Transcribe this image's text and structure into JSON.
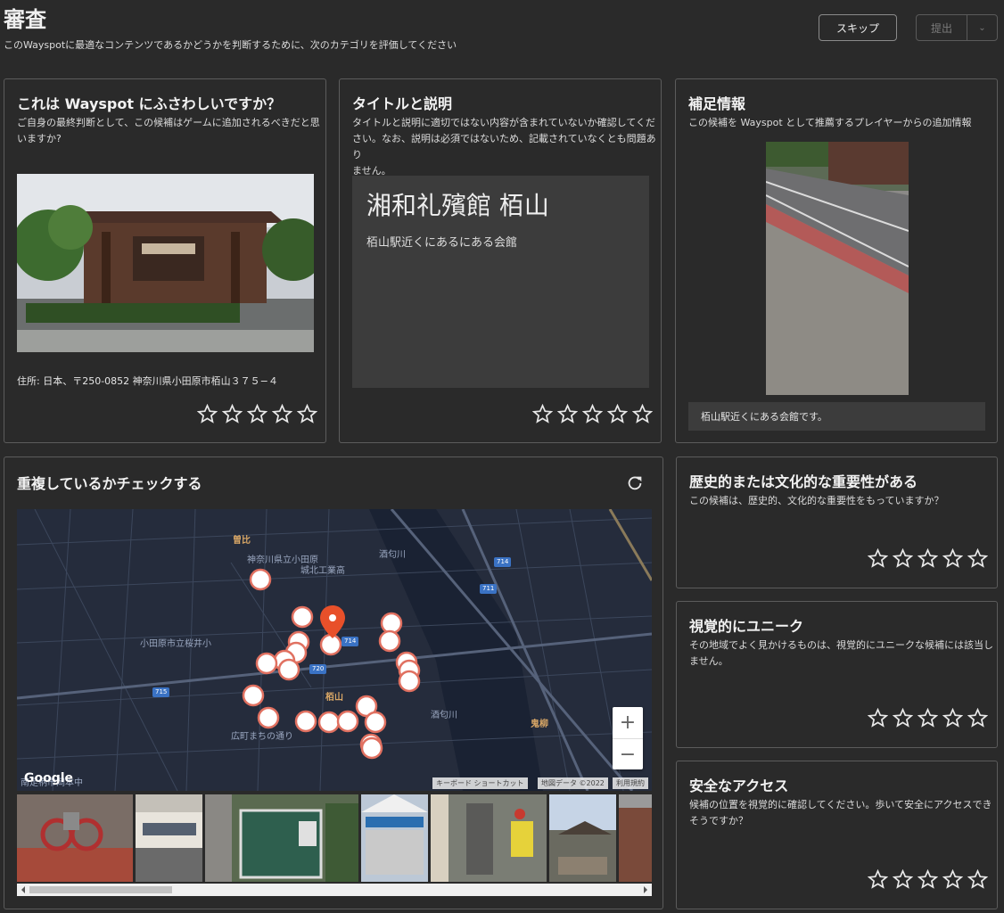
{
  "header": {
    "title": "審査",
    "subtitle": "このWayspotに最適なコンテンツであるかどうかを判断するために、次のカテゴリを評価してください",
    "skip_label": "スキップ",
    "submit_label": "提出",
    "dropdown_glyph": "⌄"
  },
  "cards": {
    "appropriate": {
      "title": "これは Wayspot にふさわしいですか？",
      "desc_line1": "ご自身の最終判断として、この候補はゲームに追加されるべきだと思",
      "desc_line2": "いますか?",
      "address": "住所: 日本、〒250-0852 神奈川県小田原市栢山３７５−４",
      "rating": 0
    },
    "title_desc": {
      "title": "タイトルと説明",
      "desc_line1": "タイトルと説明に適切ではない内容が含まれていないか確認してくだ",
      "desc_line2": "さい。なお、説明は必須ではないため、記載されていなくとも問題あり",
      "desc_line3": "ません。",
      "wayspot_title": "湘和礼殯館 栢山",
      "wayspot_desc": "栢山駅近くにあるにある会館",
      "rating": 0
    },
    "supplemental": {
      "title": "補足情報",
      "desc": "この候補を Wayspot として推薦するプレイヤーからの追加情報",
      "text": "栢山駅近くにある会館です。"
    },
    "duplicates": {
      "title": "重複しているかチェックする",
      "map": {
        "labels": {
          "soga": "曽比",
          "school1_l1": "神奈川県立小田原",
          "school1_l2": "城北工業高",
          "school2": "小田原市立桜井小",
          "kayama": "栢山",
          "kitayanagi": "鬼柳",
          "river1": "酒匂川",
          "river2": "酒匂川",
          "road_street": "広町まちの通り",
          "south": "南足柄市岡本中",
          "google": "Google",
          "badge_714a": "714",
          "badge_711": "711",
          "badge_714b": "714",
          "badge_720": "720",
          "badge_715": "715",
          "zoom_in": "+",
          "zoom_out": "−"
        },
        "attribution": {
          "shortcuts": "キーボード ショートカット",
          "data": "地図データ ©2022",
          "terms": "利用規約"
        }
      }
    },
    "historic": {
      "title": "歴史的または文化的な重要性がある",
      "desc": "この候補は、歴史的、文化的な重要性をもっていますか？",
      "rating": 0
    },
    "visual": {
      "title": "視覚的にユニーク",
      "desc_line1": "その地域でよく見かけるものは、視覚的にユニークな候補には該当し",
      "desc_line2": "ません。",
      "rating": 0
    },
    "access": {
      "title": "安全なアクセス",
      "desc_line1": "候補の位置を視覚的に確認してください。歩いて安全にアクセスでき",
      "desc_line2": "そうですか？",
      "rating": 0
    }
  },
  "colors": {
    "background": "#2a2a2a",
    "card_border": "#5c5c5c",
    "marker_fill": "#ffffff",
    "marker_stroke": "#e07060",
    "pin": "#e8502a",
    "map_bg": "#252c3c"
  }
}
